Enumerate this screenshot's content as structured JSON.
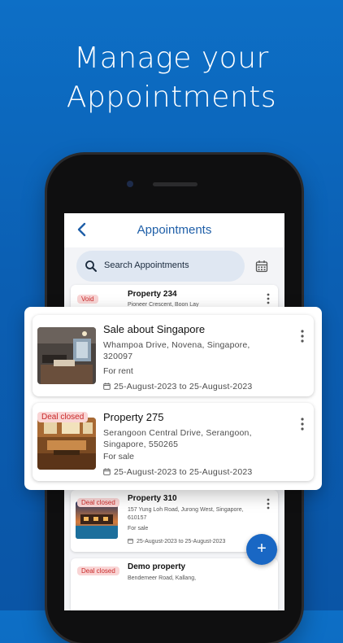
{
  "headline": {
    "line1": "Manage your",
    "line2": "Appointments"
  },
  "appbar": {
    "title": "Appointments"
  },
  "search": {
    "placeholder": "Search Appointments"
  },
  "background_list": [
    {
      "badge": "Void",
      "title": "Property 234",
      "address": "Pioneer Crescent, Boon Lay"
    },
    {
      "badge": "Deal closed",
      "title": "Property 310",
      "address": "157 Yung Loh Road, Jurong West, Singapore, 610157",
      "type": "For sale",
      "dates": "25-August-2023 to 25-August-2023"
    },
    {
      "badge": "Deal closed",
      "title": "Demo property",
      "address": "Bendemeer Road, Kallang,"
    }
  ],
  "featured": [
    {
      "title": "Sale about Singapore",
      "address": "Whampoa Drive, Novena, Singapore, 320097",
      "type": "For rent",
      "dates": "25-August-2023 to 25-August-2023"
    },
    {
      "badge": "Deal closed",
      "title": "Property 275",
      "address": "Serangoon Central Drive, Serangoon, Singapore, 550265",
      "type": "For sale",
      "dates": "25-August-2023 to 25-August-2023"
    }
  ],
  "fab_label": "+",
  "colors": {
    "accent": "#1967c4",
    "badge_text": "#c92a2a",
    "badge_bg": "#f9d5d5"
  },
  "icons": [
    "back-icon",
    "search-icon",
    "calendar-icon",
    "more-vert-icon",
    "add-icon"
  ]
}
